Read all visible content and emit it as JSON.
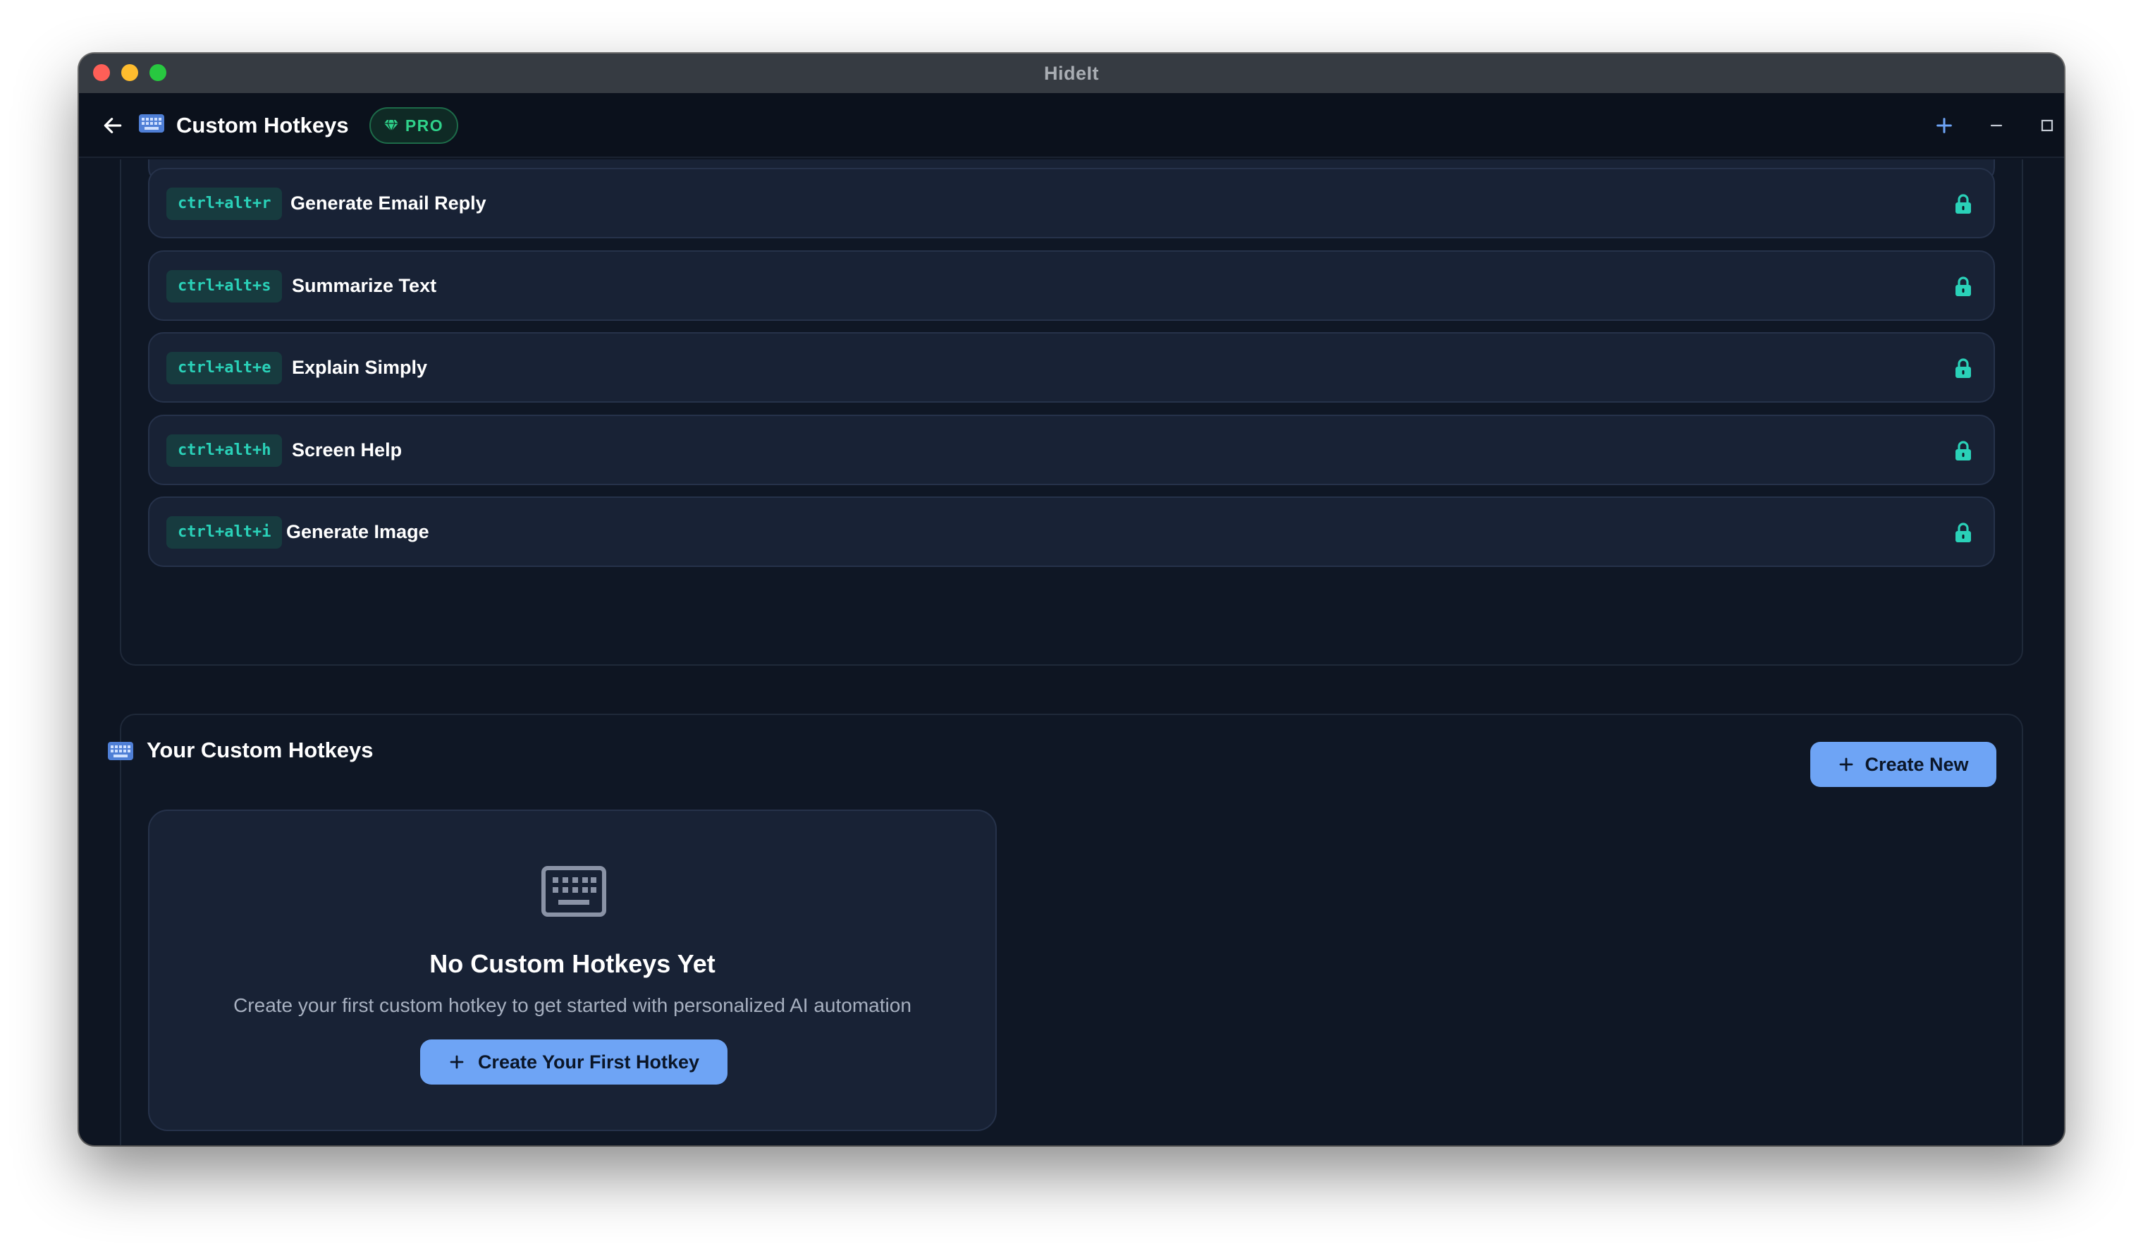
{
  "window": {
    "title": "HideIt"
  },
  "header": {
    "title": "Custom Hotkeys",
    "badge": "PRO",
    "icons": {
      "back": "arrow-left-icon",
      "keyboard": "keyboard-icon",
      "add": "plus-icon",
      "minimize": "minimize-icon",
      "maximize": "maximize-icon",
      "close": "close-icon"
    }
  },
  "builtin_hotkeys": [
    {
      "keys": "ctrl+alt+r",
      "label": "Generate Email Reply",
      "locked": true
    },
    {
      "keys": "ctrl+alt+s",
      "label": "Summarize Text",
      "locked": true
    },
    {
      "keys": "ctrl+alt+e",
      "label": "Explain Simply",
      "locked": true
    },
    {
      "keys": "ctrl+alt+h",
      "label": "Screen Help",
      "locked": true
    },
    {
      "keys": "ctrl+alt+i",
      "label": "Generate Image",
      "locked": true
    }
  ],
  "custom_section": {
    "title": "Your Custom Hotkeys",
    "create_new_label": "Create New",
    "empty": {
      "title": "No Custom Hotkeys Yet",
      "description": "Create your first custom hotkey to get started with personalized AI automation",
      "button_label": "Create Your First Hotkey"
    }
  },
  "colors": {
    "accent": "#6ea4f5",
    "key_text": "#2ad1b8",
    "pro_green": "#2fd28a",
    "background": "#0e1522",
    "card": "#182235"
  }
}
